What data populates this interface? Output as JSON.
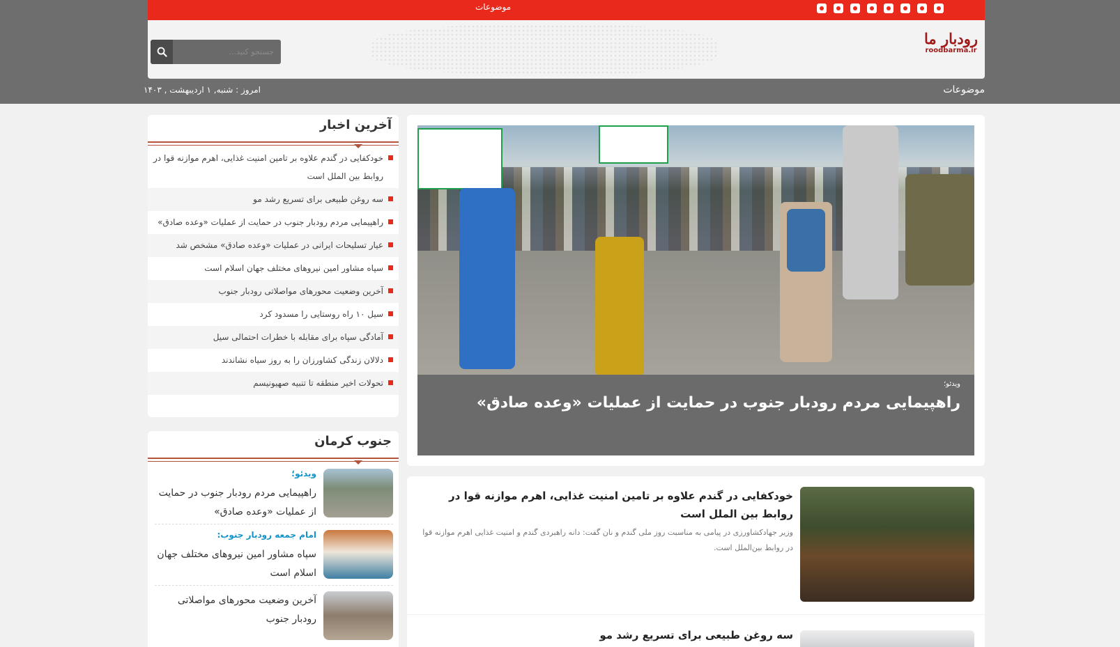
{
  "topbar": {
    "topics_label": "موضوعات",
    "social": [
      "rss-icon",
      "chat-icon",
      "app-icon",
      "eitaa-icon",
      "grid-icon",
      "twitter-icon",
      "instagram-icon",
      "telegram-icon"
    ]
  },
  "header": {
    "logo_fa": "رودبار ما",
    "logo_en": "roodbarma.ir",
    "search_placeholder": "جستجو کنید..."
  },
  "navbar": {
    "topics_label": "موضوعات",
    "date": "امروز : شنبه, ۱ اردیبهشت , ۱۴۰۳"
  },
  "featured": {
    "kicker": "ویدئو؛",
    "headline": "راهپیمایی مردم رودبار جنوب در حمایت از عملیات «وعده صادق»"
  },
  "articles": [
    {
      "title": "خودکفایی در گندم علاوه بر تامین امنیت غذایی، اهرم موازنه قوا در روابط بین الملل است",
      "lead": "وزیر جهادکشاورزی در پیامی به مناسبت روز ملی گندم و نان گفت: دانه راهبردی گندم و امنیت غذایی اهرم موازنه قوا در روابط بین‌الملل است."
    },
    {
      "title": "سه روغن طبیعی برای تسریع رشد مو"
    }
  ],
  "latest": {
    "title": "آخرین اخبار",
    "items": [
      "خودکفایی در گندم علاوه بر تامین امنیت غذایی، اهرم موازنه قوا در روابط بین الملل است",
      "سه روغن طبیعی برای تسریع رشد مو",
      "راهپیمایی مردم رودبار جنوب در حمایت از عملیات «وعده صادق»",
      "عیار تسلیحات ایرانی در عملیات «وعده صادق» مشخص شد",
      "سپاه مشاور امین نیروهای مختلف جهان اسلام است",
      "آخرین وضعیت محورهای مواصلاتی رودبار جنوب",
      "سیل ۱۰ راه روستایی را مسدود کرد",
      "آمادگی سپاه برای مقابله با خطرات احتمالی سیل",
      "دلالان زندگی کشاورزان را به روز سیاه نشاندند",
      "تحولات اخیر منطقه تا تنبیه صهیونیسم"
    ]
  },
  "south": {
    "title": "جنوب کرمان",
    "items": [
      {
        "kicker": "ویدئو؛",
        "title": "راهپیمایی مردم رودبار جنوب در حمایت از عملیات «وعده صادق»"
      },
      {
        "kicker": "امام جمعه رودبار جنوب:",
        "title": "سپاه مشاور امین نیروهای مختلف جهان اسلام است"
      },
      {
        "kicker": "",
        "title": "آخرین وضعیت محورهای مواصلاتی رودبار جنوب"
      }
    ]
  },
  "colors": {
    "brand_red": "#e8291c",
    "header_gray": "#6e6e6e",
    "kicker_blue": "#1594c9",
    "section_rule": "#b5533a"
  }
}
